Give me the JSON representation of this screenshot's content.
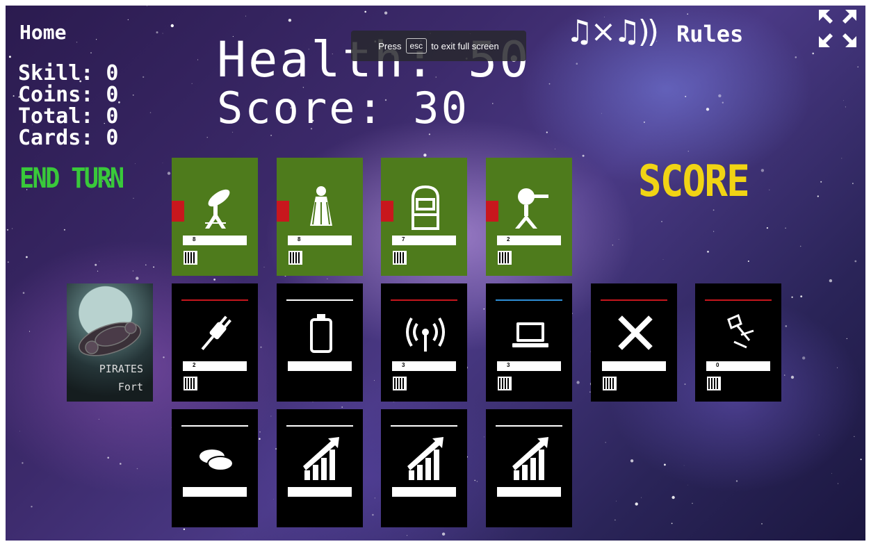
{
  "hud": {
    "home": "Home",
    "stats": [
      "Skill: 0",
      "Coins: 0",
      "Total: 0",
      "Cards: 0"
    ],
    "health": "Health: 50",
    "score": "Score: 30",
    "rules": "Rules",
    "music_icon": "♫×♫))",
    "end_turn": "END TURN",
    "score_button": "SCORE"
  },
  "toast": {
    "press": "Press",
    "key": "esc",
    "rest": "to exit full screen"
  },
  "pirates": {
    "line1": "PIRATES",
    "line2": "Fort"
  },
  "rows": {
    "top": [
      {
        "icon": "satellite-dish-icon",
        "bar": "8"
      },
      {
        "icon": "shuttlecock-icon",
        "bar": "8"
      },
      {
        "icon": "locker-icon",
        "bar": "7"
      },
      {
        "icon": "turret-icon",
        "bar": "2"
      }
    ],
    "middle": [
      {
        "icon": "plug-icon",
        "title": "",
        "bar": "2"
      },
      {
        "icon": "battery-icon",
        "title": "",
        "bar": ""
      },
      {
        "icon": "signal-tower-icon",
        "title": "",
        "bar": "3"
      },
      {
        "icon": "laptop-icon",
        "title": "",
        "bar": "3"
      },
      {
        "icon": "ruler-pencil-icon",
        "title": "",
        "bar": ""
      },
      {
        "icon": "drone-icon",
        "title": "",
        "bar": "0"
      }
    ],
    "bottom": [
      {
        "icon": "coins-icon"
      },
      {
        "icon": "growth-chart-icon"
      },
      {
        "icon": "growth-chart-icon"
      },
      {
        "icon": "growth-chart-icon"
      }
    ]
  },
  "colors": {
    "card_green": "#4e7b1c",
    "end_turn": "#39c93a",
    "score": "#f1d414",
    "accent_red": "#c8171d",
    "accent_blue": "#2f8fd6"
  }
}
